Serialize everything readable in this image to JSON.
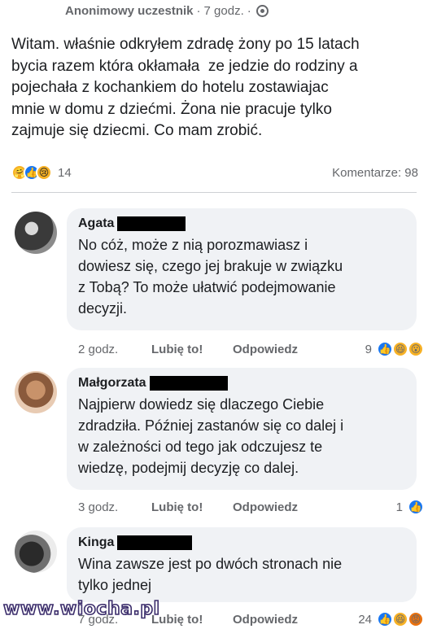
{
  "post": {
    "author": "Anonimowy uczestnik",
    "separator": "·",
    "time": "7 godz.",
    "audience_icon": "globe-icon",
    "text": "Witam. właśnie odkryłem zdradę żony po 15 latach\nbycia razem która okłamała  ze jedzie do rodziny a\npojechała z kochankiem do hotelu zostawiajac\nmnie w domu z dziećmi. Żona nie pracuje tylko\nzajmuje się dziecmi. Co mam zrobić.",
    "reactions_count": "14",
    "comments_label": "Komentarze: 98",
    "reaction_icons": [
      "care-icon",
      "like-icon",
      "sad-icon"
    ]
  },
  "comments": [
    {
      "name": "Agata",
      "text": "No cóż, może z nią porozmawiasz i\ndowiesz się, czego jej brakuje w związku\nz Tobą? To może ułatwić podejmowanie\ndecyzji.",
      "time": "2 godz.",
      "like_label": "Lubię to!",
      "reply_label": "Odpowiedz",
      "reactions_count": "9",
      "reaction_icons": [
        "like-icon",
        "haha-icon",
        "wow-icon"
      ]
    },
    {
      "name": "Małgorzata",
      "text": "Najpierw dowiedz się dlaczego Ciebie\nzdradziła. Później zastanów się co dalej i\nw zależności od tego jak odczujesz te\nwiedzę, podejmij decyzję co dalej.",
      "time": "3 godz.",
      "like_label": "Lubię to!",
      "reply_label": "Odpowiedz",
      "reactions_count": "1",
      "reaction_icons": [
        "like-icon"
      ]
    },
    {
      "name": "Kinga",
      "text": "Wina zawsze jest po dwóch stronach nie\ntylko jednej",
      "time": "7 godz.",
      "like_label": "Lubię to!",
      "reply_label": "Odpowiedz",
      "reactions_count": "24",
      "reaction_icons": [
        "like-icon",
        "haha-icon",
        "angry-icon"
      ]
    }
  ],
  "watermark": "www.wiocha.pl"
}
